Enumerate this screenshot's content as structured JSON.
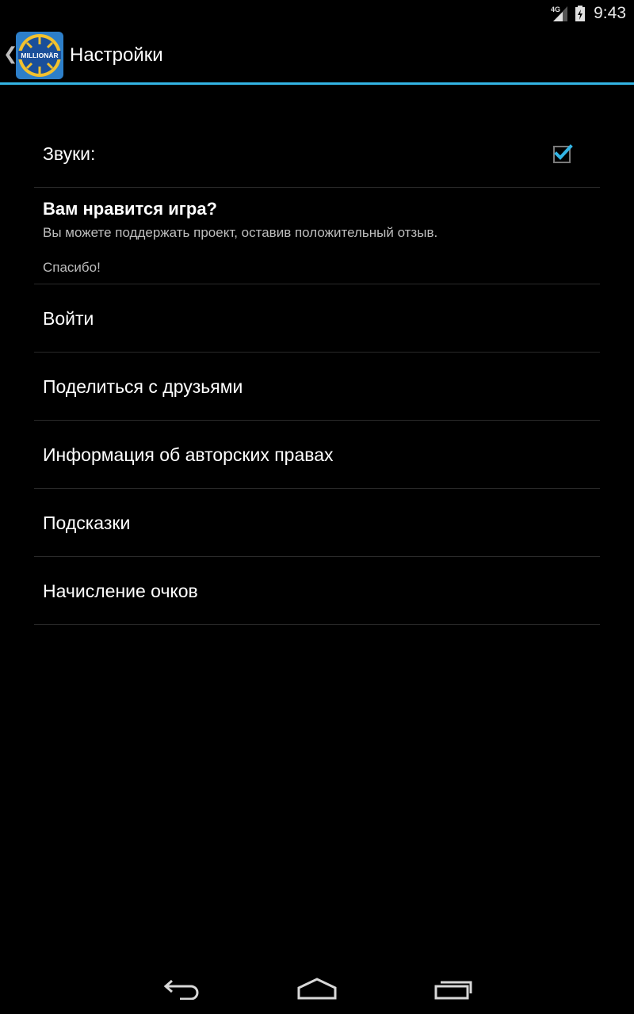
{
  "status_bar": {
    "network_label": "4G",
    "time": "9:43",
    "icons": [
      "signal-icon",
      "battery-icon"
    ]
  },
  "action_bar": {
    "title": "Настройки",
    "logo_text": "MILLIONÄR",
    "accent_color": "#33b5e5"
  },
  "preferences": {
    "sound": {
      "label": "Звуки:",
      "checked": true
    },
    "rate": {
      "title": "Вам нравится игра?",
      "summary": "Вы можете поддержать проект, оставив положительный отзыв.",
      "thanks": "Спасибо!"
    },
    "items": [
      {
        "label": "Войти"
      },
      {
        "label": "Поделиться с друзьями"
      },
      {
        "label": "Информация об авторских правах"
      },
      {
        "label": "Подсказки"
      },
      {
        "label": "Начисление очков"
      }
    ]
  },
  "nav_bar": {
    "icons": [
      "back-icon",
      "home-icon",
      "recents-icon"
    ]
  }
}
